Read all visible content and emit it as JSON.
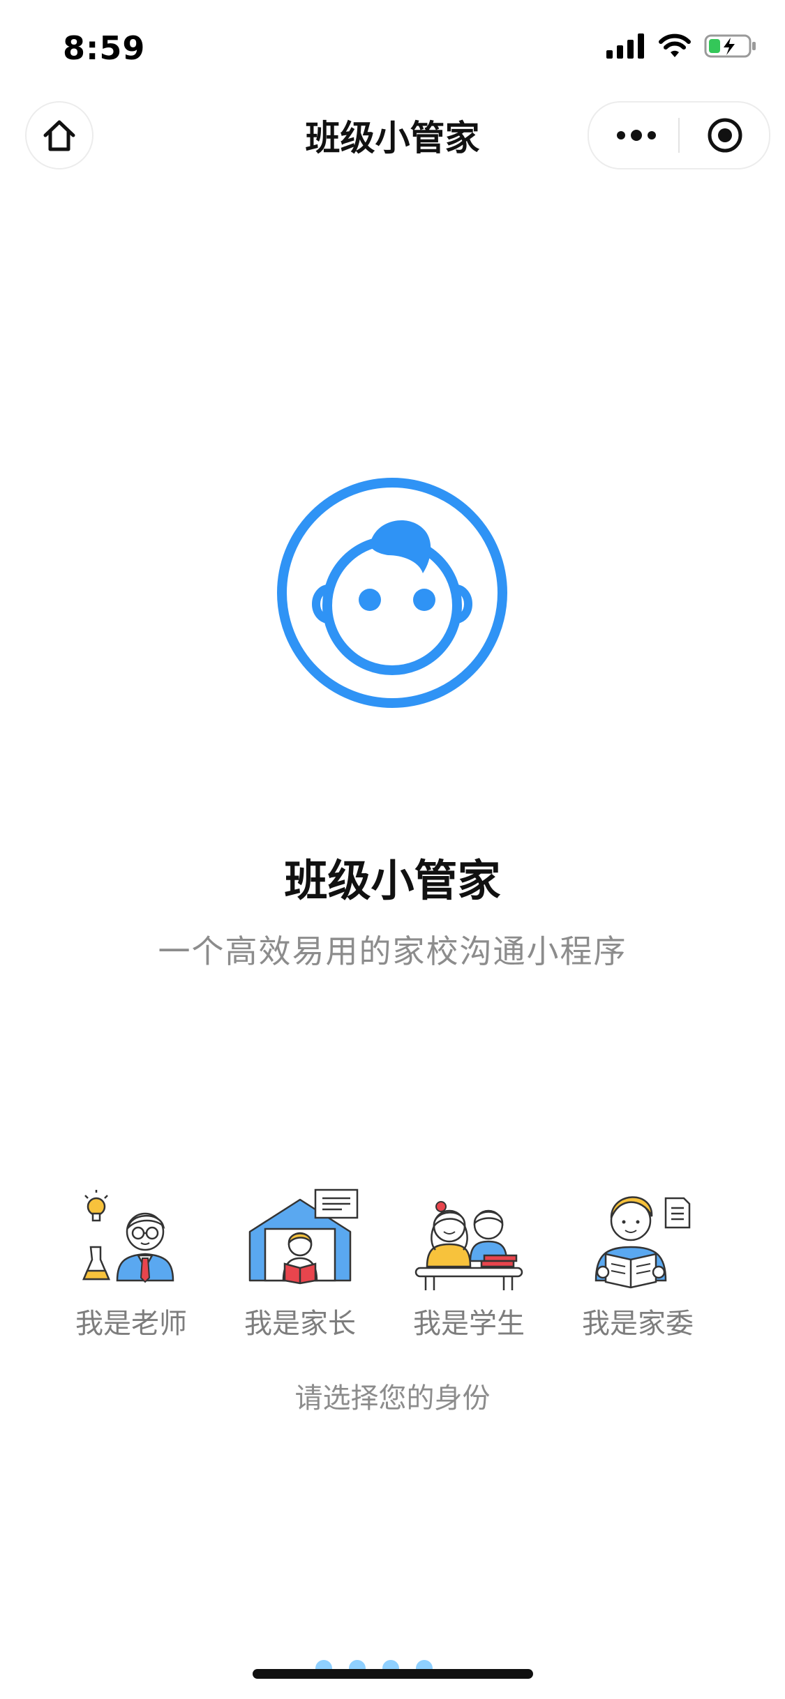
{
  "status_bar": {
    "time": "8:59",
    "icons": [
      "signal-icon",
      "wifi-icon",
      "battery-charging-icon"
    ]
  },
  "nav": {
    "title": "班级小管家",
    "home_icon": "home-icon",
    "more_icon": "more-dots-icon",
    "close_icon": "mini-program-close-icon"
  },
  "hero": {
    "logo_icon": "baby-face-logo",
    "logo_color": "#2F93F5",
    "app_name": "班级小管家",
    "description": "一个高效易用的家校沟通小程序"
  },
  "roles": {
    "items": [
      {
        "label": "我是老师",
        "icon": "teacher-illustration"
      },
      {
        "label": "我是家长",
        "icon": "parent-illustration"
      },
      {
        "label": "我是学生",
        "icon": "student-illustration"
      },
      {
        "label": "我是家委",
        "icon": "committee-illustration"
      }
    ],
    "hint": "请选择您的身份"
  },
  "pager": {
    "page_count": 4,
    "dot_color": "#8FD0FF"
  },
  "colors": {
    "accent": "#2F93F5",
    "illustration_blue": "#5AA8F0",
    "illustration_yellow": "#F7C23C",
    "illustration_red": "#E8454D"
  }
}
